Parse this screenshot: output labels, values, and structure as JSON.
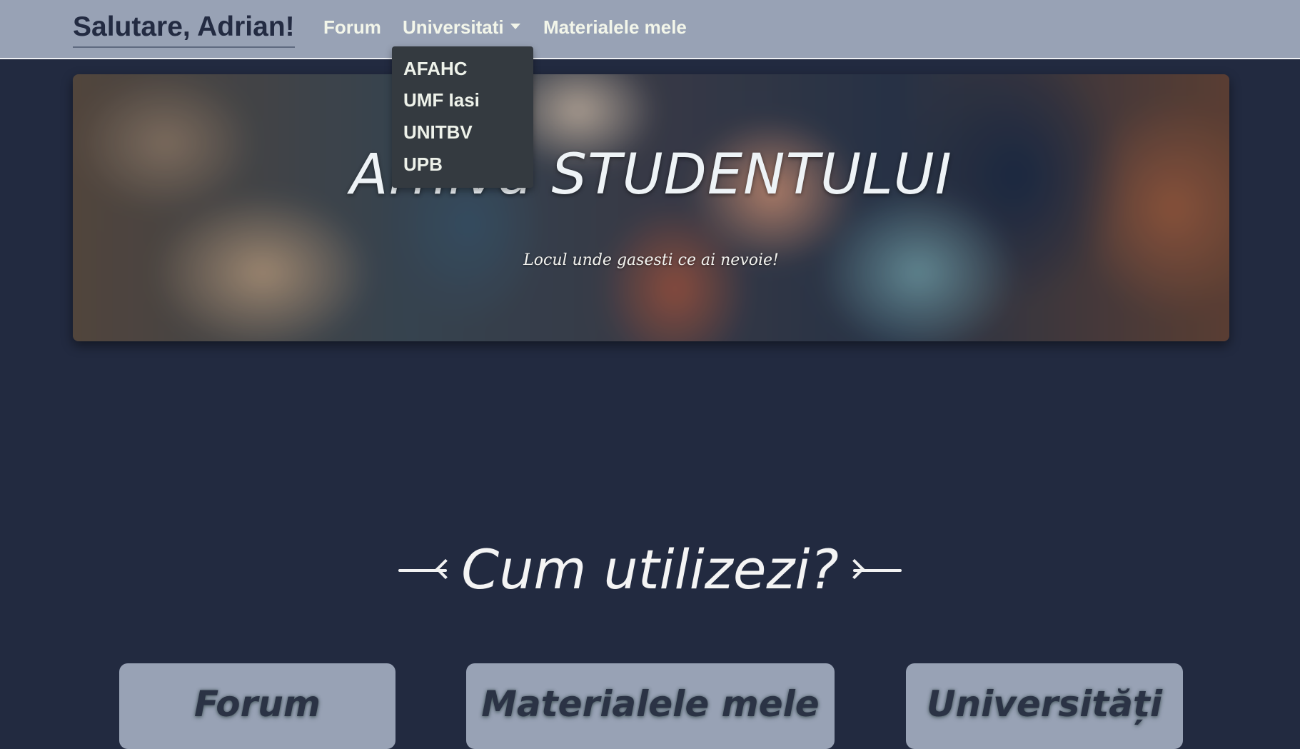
{
  "navbar": {
    "greeting": "Salutare, Adrian!",
    "links": {
      "forum": "Forum",
      "universities": "Universitati",
      "materials": "Materialele mele"
    },
    "dropdown_items": [
      "AFAHC",
      "UMF Iasi",
      "UNITBV",
      "UPB"
    ]
  },
  "hero": {
    "title": "Arhiva STUDENTULUI",
    "subtitle": "Locul unde gasesti ce ai nevoie!"
  },
  "section": {
    "title": "Cum utilizezi?"
  },
  "cards": [
    "Forum",
    "Materialele mele",
    "Universități"
  ],
  "colors": {
    "page_background": "#222a40",
    "navbar_background": "#98a2b5",
    "dropdown_background": "#343a40",
    "card_background": "#98a2b5",
    "brand_text": "#232b42"
  }
}
